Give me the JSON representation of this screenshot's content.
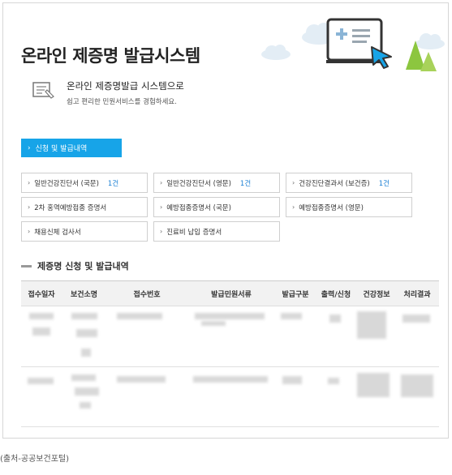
{
  "hero": {
    "title": "온라인 제증명 발급시스템"
  },
  "intro": {
    "title": "온라인 제증명발급 시스템으로",
    "subtitle": "쉽고 편리한 민원서비스를 경험하세요."
  },
  "tab": {
    "label": "신청 및 발급내역"
  },
  "certificates": [
    {
      "label": "일반건강진단서 (국문)",
      "count": "1건"
    },
    {
      "label": "일반건강진단서 (영문)",
      "count": "1건"
    },
    {
      "label": "건강진단결과서 (보건증)",
      "count": "1건"
    },
    {
      "label": "2차 홍역예방접종 증명서",
      "count": ""
    },
    {
      "label": "예방접종증명서 (국문)",
      "count": ""
    },
    {
      "label": "예방접종증명서 (영문)",
      "count": ""
    },
    {
      "label": "채용신체 검사서",
      "count": ""
    },
    {
      "label": "진료비 납입 증명서",
      "count": ""
    }
  ],
  "history": {
    "title": "제증명 신청 및 발급내역",
    "columns": [
      "접수일자",
      "보건소명",
      "접수번호",
      "발급민원서류",
      "발급구분",
      "출력/신청",
      "건강정보",
      "처리결과"
    ]
  },
  "caption": "(출처-공공보건포털)",
  "colors": {
    "accent": "#17a4e8",
    "link": "#1a7fd4",
    "cloud": "#e3edf5",
    "tree": "#8cc63f"
  }
}
